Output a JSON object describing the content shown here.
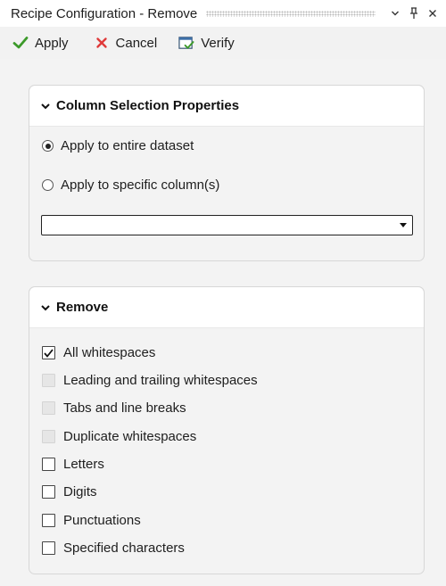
{
  "window": {
    "title": "Recipe Configuration - Remove",
    "icons": [
      "chevron-down-icon",
      "pin-icon",
      "close-icon"
    ]
  },
  "toolbar": {
    "apply_label": "Apply",
    "cancel_label": "Cancel",
    "verify_label": "Verify",
    "colors": {
      "apply": "#3c9a2a",
      "cancel": "#e03a3a"
    }
  },
  "column_selection": {
    "title": "Column Selection Properties",
    "options": [
      {
        "label": "Apply to entire dataset",
        "selected": true
      },
      {
        "label": "Apply to specific column(s)",
        "selected": false
      }
    ],
    "column_select_value": ""
  },
  "remove": {
    "title": "Remove",
    "options": [
      {
        "label": "All whitespaces",
        "checked": true,
        "enabled": true
      },
      {
        "label": "Leading and trailing whitespaces",
        "checked": false,
        "enabled": false
      },
      {
        "label": "Tabs and line breaks",
        "checked": false,
        "enabled": false
      },
      {
        "label": "Duplicate whitespaces",
        "checked": false,
        "enabled": false
      },
      {
        "label": "Letters",
        "checked": false,
        "enabled": true
      },
      {
        "label": "Digits",
        "checked": false,
        "enabled": true
      },
      {
        "label": "Punctuations",
        "checked": false,
        "enabled": true
      },
      {
        "label": "Specified characters",
        "checked": false,
        "enabled": true
      }
    ]
  }
}
